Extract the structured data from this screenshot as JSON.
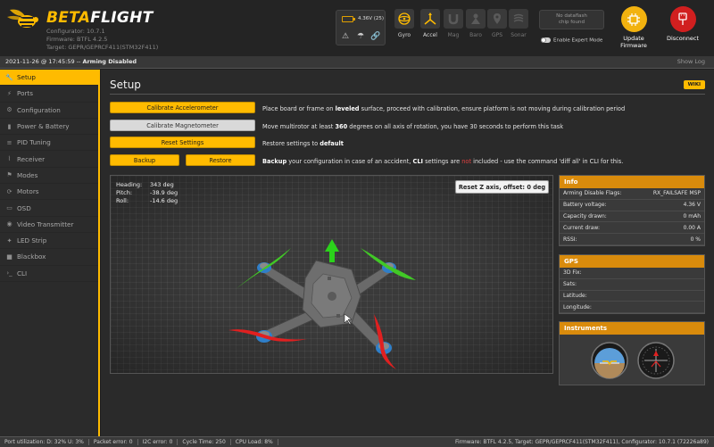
{
  "colors": {
    "accent": "#ffbb00",
    "panel_header": "#d98b0c",
    "firmware_btn": "#f2b20f",
    "disconnect_btn": "#d11f1f"
  },
  "header": {
    "brand_beta": "BETA",
    "brand_flight": "FLIGHT",
    "configurator": "Configurator: 10.7.1",
    "firmware": "Firmware: BTFL 4.2.5",
    "target": "Target: GEPR/GEPRCF411(STM32F411)",
    "battery": "4.36V (25)",
    "sensors": [
      {
        "label": "Gyro",
        "icon": "gyro-icon",
        "active": true
      },
      {
        "label": "Accel",
        "icon": "accel-icon",
        "active": true
      },
      {
        "label": "Mag",
        "icon": "mag-icon",
        "active": false
      },
      {
        "label": "Baro",
        "icon": "baro-icon",
        "active": false
      },
      {
        "label": "GPS",
        "icon": "gps-icon",
        "active": false
      },
      {
        "label": "Sonar",
        "icon": "sonar-icon",
        "active": false
      }
    ],
    "dataflash_line1": "No dataflash",
    "dataflash_line2": "chip found",
    "expert_mode": "Enable Expert Mode",
    "update_firmware_line1": "Update",
    "update_firmware_line2": "Firmware",
    "disconnect": "Disconnect"
  },
  "status": {
    "datetime": "2021-11-26 @ 17:45:59",
    "separator": " -- ",
    "state": "Arming Disabled",
    "show_log": "Show Log"
  },
  "sidebar": {
    "items": [
      {
        "label": "Setup",
        "icon": "wrench-icon",
        "active": true
      },
      {
        "label": "Ports",
        "icon": "ports-icon",
        "active": false
      },
      {
        "label": "Configuration",
        "icon": "gear-icon",
        "active": false
      },
      {
        "label": "Power & Battery",
        "icon": "battery-icon",
        "active": false
      },
      {
        "label": "PID Tuning",
        "icon": "pid-icon",
        "active": false
      },
      {
        "label": "Receiver",
        "icon": "receiver-icon",
        "active": false
      },
      {
        "label": "Modes",
        "icon": "modes-icon",
        "active": false
      },
      {
        "label": "Motors",
        "icon": "motor-icon",
        "active": false
      },
      {
        "label": "OSD",
        "icon": "osd-icon",
        "active": false
      },
      {
        "label": "Video Transmitter",
        "icon": "vtx-icon",
        "active": false
      },
      {
        "label": "LED Strip",
        "icon": "led-icon",
        "active": false
      },
      {
        "label": "Blackbox",
        "icon": "blackbox-icon",
        "active": false
      },
      {
        "label": "CLI",
        "icon": "cli-icon",
        "active": false
      }
    ]
  },
  "setup": {
    "title": "Setup",
    "wiki": "WIKI",
    "buttons": {
      "calibrate_accel": "Calibrate Accelerometer",
      "calibrate_mag": "Calibrate Magnetometer",
      "reset_settings": "Reset Settings",
      "backup": "Backup",
      "restore": "Restore"
    },
    "desc_accel_pre": "Place board or frame on ",
    "desc_accel_bold": "leveled",
    "desc_accel_post": " surface, proceed with calibration, ensure platform is not moving during calibration period",
    "desc_mag_pre": "Move multirotor at least ",
    "desc_mag_bold": "360",
    "desc_mag_post": " degrees on all axis of rotation, you have 30 seconds to perform this task",
    "desc_reset_pre": "Restore settings to ",
    "desc_reset_bold": "default",
    "desc_backup_bold1": "Backup",
    "desc_backup_mid1": " your configuration in case of an accident, ",
    "desc_backup_bold2": "CLI",
    "desc_backup_mid2": " settings are ",
    "desc_backup_red": "not",
    "desc_backup_post": " included - use the command 'diff all' in CLI for this.",
    "attitude": {
      "heading_label": "Heading:",
      "heading_value": "343 deg",
      "pitch_label": "Pitch:",
      "pitch_value": "-38.9 deg",
      "roll_label": "Roll:",
      "roll_value": "-14.6 deg"
    },
    "reset_z": "Reset Z axis, offset: 0 deg"
  },
  "info": {
    "title": "Info",
    "rows": [
      {
        "label": "Arming Disable Flags:",
        "value": "RX_FAILSAFE  MSP"
      },
      {
        "label": "Battery voltage:",
        "value": "4.36 V"
      },
      {
        "label": "Capacity drawn:",
        "value": "0 mAh"
      },
      {
        "label": "Current draw:",
        "value": "0.00 A"
      },
      {
        "label": "RSSI:",
        "value": "0 %"
      }
    ]
  },
  "gps": {
    "title": "GPS",
    "rows": [
      {
        "label": "3D Fix:",
        "value": ""
      },
      {
        "label": "Sats:",
        "value": ""
      },
      {
        "label": "Latitude:",
        "value": ""
      },
      {
        "label": "Longitude:",
        "value": ""
      }
    ]
  },
  "instruments": {
    "title": "Instruments"
  },
  "footer": {
    "port_util": "Port utilization: D: 32% U: 3%",
    "packet_error": "Packet error: 0",
    "i2c_error": "I2C error: 0",
    "cycle_time": "Cycle Time: 250",
    "cpu_load": "CPU Load: 8%",
    "version": "Firmware: BTFL 4.2.5, Target: GEPR/GEPRCF411(STM32F411), Configurator: 10.7.1 (72226a89)"
  }
}
